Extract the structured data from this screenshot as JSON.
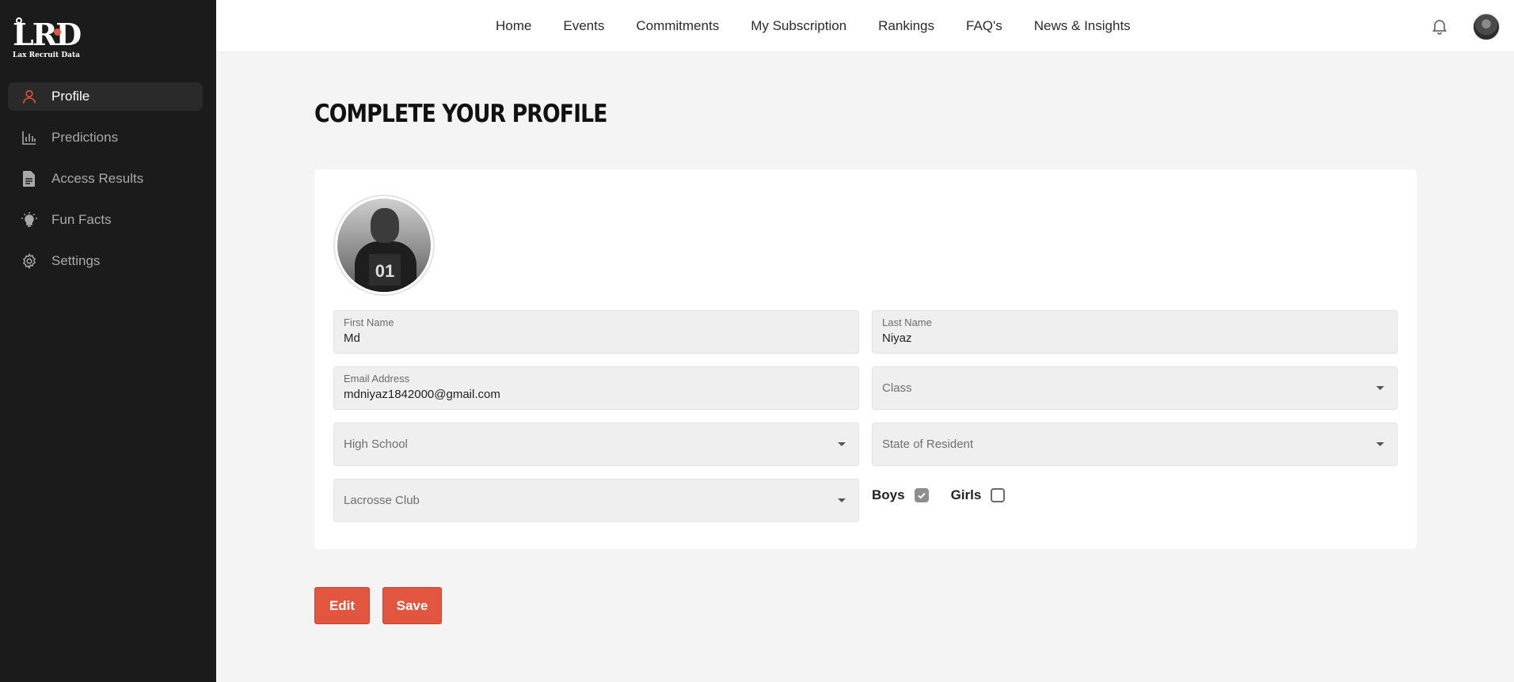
{
  "brand": {
    "logo_text": "LRD",
    "logo_subtitle": "Lax Recruit Data"
  },
  "sidebar": {
    "items": [
      {
        "label": "Profile",
        "icon": "user-icon",
        "active": true
      },
      {
        "label": "Predictions",
        "icon": "bar-chart-icon",
        "active": false
      },
      {
        "label": "Access Results",
        "icon": "document-icon",
        "active": false
      },
      {
        "label": "Fun Facts",
        "icon": "lightbulb-icon",
        "active": false
      },
      {
        "label": "Settings",
        "icon": "gear-icon",
        "active": false
      }
    ]
  },
  "topnav": {
    "links": [
      "Home",
      "Events",
      "Commitments",
      "My Subscription",
      "Rankings",
      "FAQ's",
      "News & Insights"
    ],
    "notifications_icon": "bell-icon"
  },
  "main": {
    "title": "COMPLETE YOUR PROFILE",
    "form": {
      "first_name": {
        "label": "First Name",
        "value": "Md"
      },
      "last_name": {
        "label": "Last Name",
        "value": "Niyaz"
      },
      "email": {
        "label": "Email Address",
        "value": "mdniyaz1842000@gmail.com"
      },
      "class": {
        "placeholder": "Class"
      },
      "high_school": {
        "placeholder": "High School"
      },
      "state": {
        "placeholder": "State of Resident"
      },
      "lacrosse_club": {
        "placeholder": "Lacrosse Club"
      },
      "boys": {
        "label": "Boys",
        "checked": true
      },
      "girls": {
        "label": "Girls",
        "checked": false
      }
    },
    "buttons": {
      "edit": "Edit",
      "save": "Save"
    }
  },
  "colors": {
    "accent": "#e2553f",
    "sidebar_bg": "#1b1b1b",
    "page_bg": "#f4f4f4"
  }
}
